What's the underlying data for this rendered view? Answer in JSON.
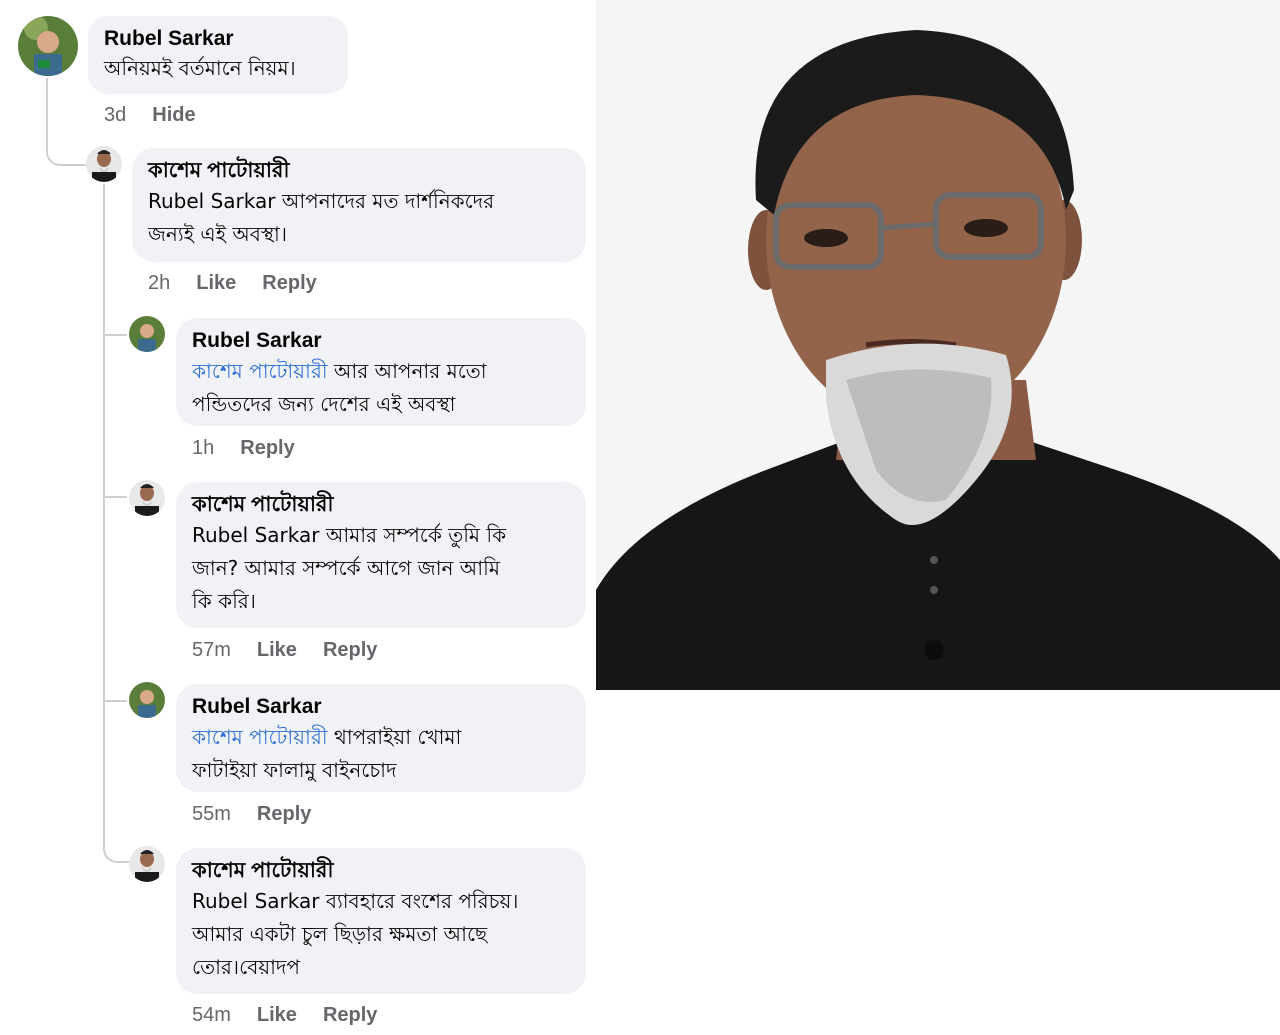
{
  "thread": {
    "comments": [
      {
        "author": "Rubel Sarkar",
        "text": "অনিয়মই বর্তমানে নিয়ম।",
        "time": "3d",
        "action_1": "Hide"
      },
      {
        "author": "কাশেম পাটোয়ারী",
        "text_line1": "Rubel Sarkar আপনাদের মত দার্শনিকদের",
        "text_line2": "জন্যই এই অবস্থা।",
        "time": "2h",
        "action_1": "Like",
        "action_2": "Reply"
      },
      {
        "author": "Rubel Sarkar",
        "mention": "কাশেম পাটোয়ারী",
        "text_line1": " আর আপনার মতো",
        "text_line2": "পন্ডিতদের জন্য দেশের এই অবস্থা",
        "time": "1h",
        "action_1": "Reply"
      },
      {
        "author": "কাশেম পাটোয়ারী",
        "text_line1": "Rubel Sarkar আমার সম্পর্কে তুমি কি",
        "text_line2": "জান? আমার সম্পর্কে  আগে জান আমি",
        "text_line3": "কি করি।",
        "time": "57m",
        "action_1": "Like",
        "action_2": "Reply"
      },
      {
        "author": "Rubel Sarkar",
        "mention": "কাশেম পাটোয়ারী",
        "text_line1": " থাপরাইয়া খোমা",
        "text_line2": "ফাটাইয়া ফালামু বাইনচোদ",
        "time": "55m",
        "action_1": "Reply"
      },
      {
        "author": "কাশেম পাটোয়ারী",
        "text_line1": "Rubel Sarkar ব্যাবহারে বংশের পরিচয়।",
        "text_line2": "আমার একটা চুল ছিড়ার ক্ষমতা আছে",
        "text_line3": "তোর।বেয়াদপ",
        "time": "54m",
        "action_1": "Like",
        "action_2": "Reply"
      }
    ]
  },
  "colors": {
    "bubble": "#f0f2f5",
    "meta": "#65676b",
    "mention": "#2d6fd3",
    "thread_line": "#ccd0d5"
  },
  "icons": [
    "avatar-rubel",
    "avatar-kashem",
    "portrait-photo"
  ]
}
